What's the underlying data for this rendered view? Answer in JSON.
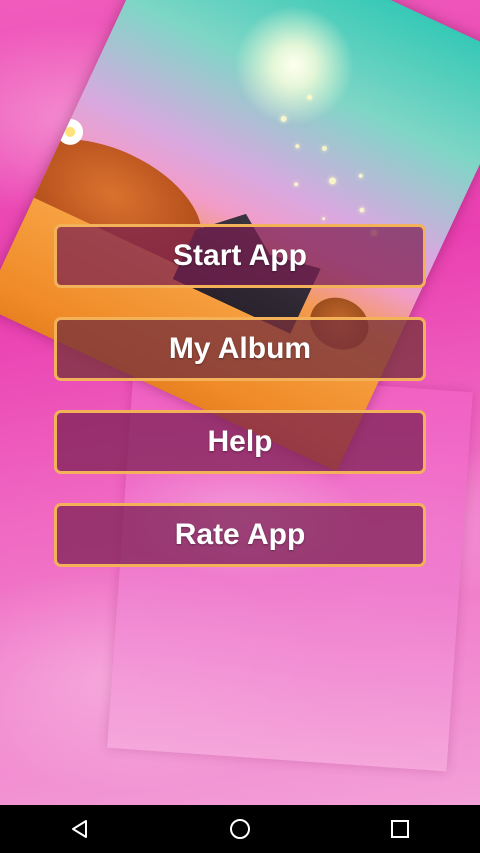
{
  "menu": {
    "items": [
      {
        "label": "Start App"
      },
      {
        "label": "My Album"
      },
      {
        "label": "Help"
      },
      {
        "label": "Rate App"
      }
    ]
  },
  "icons": {
    "back": "back-triangle-icon",
    "home": "home-circle-icon",
    "recents": "recents-square-icon"
  },
  "colors": {
    "background": "#e93fb0",
    "button_fill": "#781e50",
    "button_border": "#f3b25a",
    "button_text": "#ffffff",
    "navbar": "#000000"
  }
}
